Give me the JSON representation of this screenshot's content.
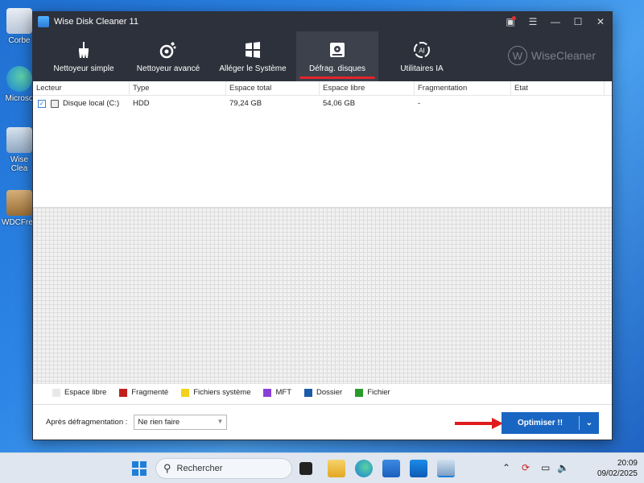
{
  "desktop": {
    "icons": [
      {
        "label": "Corbe"
      },
      {
        "label": "Microso"
      },
      {
        "label": "Wise Clea"
      },
      {
        "label": "WDCFree"
      }
    ]
  },
  "window": {
    "title": "Wise Disk Cleaner 11",
    "tabs": [
      {
        "label": "Nettoyeur simple"
      },
      {
        "label": "Nettoyeur avancé"
      },
      {
        "label": "Alléger le Système"
      },
      {
        "label": "Défrag. disques"
      },
      {
        "label": "Utilitaires IA"
      }
    ],
    "brand": "WiseCleaner",
    "brand_letter": "W"
  },
  "table": {
    "headers": [
      "Lecteur",
      "Type",
      "Espace total",
      "Espace libre",
      "Fragmentation",
      "Etat"
    ],
    "rows": [
      {
        "drive": "Disque local (C:)",
        "type": "HDD",
        "total": "79,24 GB",
        "free": "54,06 GB",
        "frag": "-",
        "state": ""
      }
    ]
  },
  "legend": [
    {
      "label": "Espace libre",
      "color": "#e8e8e8"
    },
    {
      "label": "Fragmenté",
      "color": "#c0201c"
    },
    {
      "label": "Fichiers système",
      "color": "#f2d21c"
    },
    {
      "label": "MFT",
      "color": "#8a3fd6"
    },
    {
      "label": "Dossier",
      "color": "#1d5aa8"
    },
    {
      "label": "Fichier",
      "color": "#2a9a2a"
    }
  ],
  "bottom": {
    "after_label": "Après défragmentation :",
    "after_value": "Ne rien faire",
    "optimize_label": "Optimiser !!"
  },
  "taskbar": {
    "search_placeholder": "Rechercher",
    "time": "20:09",
    "date": "09/02/2025"
  },
  "colors": {
    "accent": "#1966c2",
    "toolbar_bg": "#2d313b",
    "active_underline": "#e3232b"
  }
}
